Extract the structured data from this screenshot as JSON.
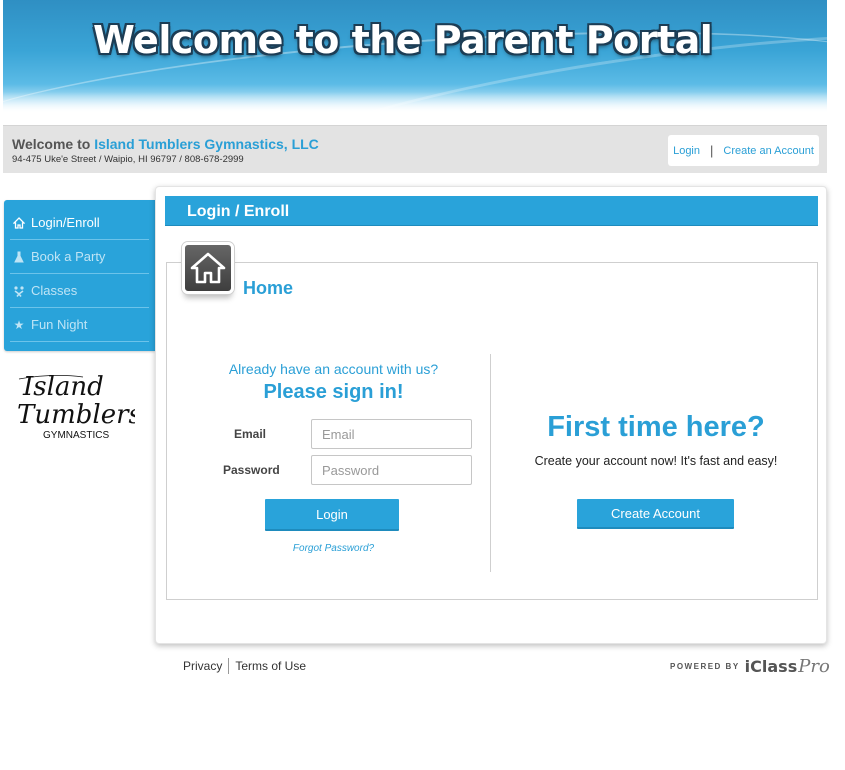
{
  "banner": {
    "title": "Welcome to the Parent Portal"
  },
  "business": {
    "welcome_prefix": "Welcome to",
    "name": "Island Tumblers Gymnastics, LLC",
    "address": "94-475 Uke'e Street / Waipio, HI 96797 / 808-678-2999"
  },
  "auth_links": {
    "login": "Login",
    "separator": "|",
    "create": "Create an Account"
  },
  "sidebar": {
    "items": [
      {
        "label": "Login/Enroll",
        "icon": "home-icon",
        "active": true
      },
      {
        "label": "Book a Party",
        "icon": "flask-icon",
        "active": false
      },
      {
        "label": "Classes",
        "icon": "gymnast-icon",
        "active": false
      },
      {
        "label": "Fun Night",
        "icon": "star-icon",
        "active": false
      }
    ]
  },
  "logo": {
    "line1": "Island",
    "line2": "Tumblers",
    "line3": "GYMNASTICS"
  },
  "page": {
    "section_title": "Login / Enroll",
    "home_heading": "Home"
  },
  "login_form": {
    "already": "Already have an account with us?",
    "signin": "Please sign in!",
    "email_label": "Email",
    "email_placeholder": "Email",
    "password_label": "Password",
    "password_placeholder": "Password",
    "login_button": "Login",
    "forgot": "Forgot Password?"
  },
  "signup": {
    "heading": "First time here?",
    "subtext": "Create your account now! It's fast and easy!",
    "button": "Create Account"
  },
  "footer": {
    "privacy": "Privacy",
    "terms": "Terms of Use",
    "powered_by": "POWERED BY",
    "brand": "iClass",
    "brand_suffix": "Pro"
  },
  "colors": {
    "accent": "#29a3da",
    "link": "#2a9fd6"
  }
}
